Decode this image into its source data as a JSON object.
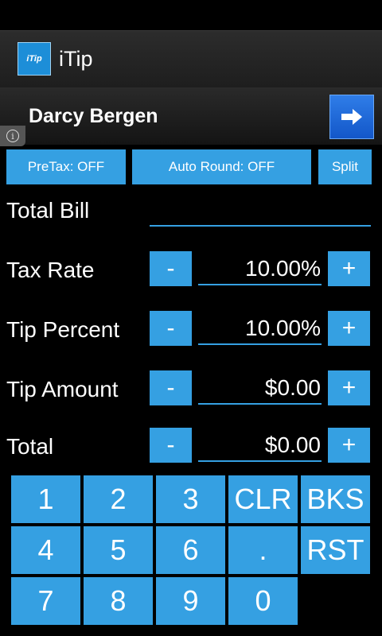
{
  "app": {
    "title": "iTip",
    "logo_text": "iTip",
    "logo_subtext": ""
  },
  "ad": {
    "name": "Darcy Bergen",
    "info_symbol": "i"
  },
  "options": {
    "pretax": "PreTax: OFF",
    "auto_round": "Auto Round: OFF",
    "split": "Split"
  },
  "fields": {
    "total_bill": {
      "label": "Total Bill",
      "value": ""
    },
    "tax_rate": {
      "label": "Tax Rate",
      "value": "10.00%"
    },
    "tip_percent": {
      "label": "Tip Percent",
      "value": "10.00%"
    },
    "tip_amount": {
      "label": "Tip Amount",
      "value": "$0.00"
    },
    "total": {
      "label": "Total",
      "value": "$0.00"
    }
  },
  "stepper": {
    "minus": "-",
    "plus": "+"
  },
  "keypad": {
    "k1": "1",
    "k2": "2",
    "k3": "3",
    "clr": "CLR",
    "bks": "BKS",
    "k4": "4",
    "k5": "5",
    "k6": "6",
    "dot": ".",
    "rst": "RST",
    "k7": "7",
    "k8": "8",
    "k9": "9",
    "k0": "0"
  },
  "colors": {
    "accent": "#35a0e2",
    "background": "#000000",
    "ad_button": "#1f6bd8"
  }
}
